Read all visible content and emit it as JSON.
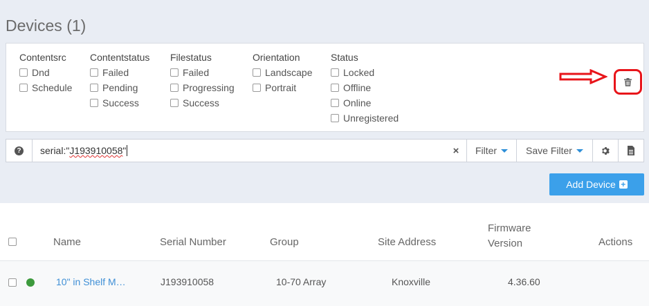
{
  "page": {
    "title": "Devices (1)"
  },
  "filters": {
    "groups": [
      {
        "title": "Contentsrc",
        "options": [
          "Dnd",
          "Schedule"
        ]
      },
      {
        "title": "Contentstatus",
        "options": [
          "Failed",
          "Pending",
          "Success"
        ]
      },
      {
        "title": "Filestatus",
        "options": [
          "Failed",
          "Progressing",
          "Success"
        ]
      },
      {
        "title": "Orientation",
        "options": [
          "Landscape",
          "Portrait"
        ]
      },
      {
        "title": "Status",
        "options": [
          "Locked",
          "Offline",
          "Online",
          "Unregistered"
        ]
      }
    ]
  },
  "search": {
    "prefix": "serial:\"",
    "serial": "J193910058",
    "suffix": "\"",
    "help_icon": "?",
    "clear_icon": "×",
    "filter_label": "Filter",
    "save_filter_label": "Save Filter",
    "gear_icon": "gear-icon",
    "doc_icon": "document-icon"
  },
  "toolbar": {
    "add_device_label": "Add Device",
    "add_icon": "+"
  },
  "table": {
    "columns": {
      "name": "Name",
      "serial": "Serial Number",
      "group": "Group",
      "site": "Site Address",
      "firmware_line1": "Firmware",
      "firmware_line2": "Version",
      "actions": "Actions"
    },
    "rows": [
      {
        "status_color": "#3d9a3d",
        "name": "10\" in Shelf M…",
        "serial": "J193910058",
        "group": "10-70 Array",
        "site": "Knoxville",
        "firmware": "4.36.60"
      }
    ]
  },
  "colors": {
    "accent": "#3ba0ea",
    "link": "#3f8fd6",
    "online": "#3d9a3d",
    "highlight": "#e8141a"
  }
}
